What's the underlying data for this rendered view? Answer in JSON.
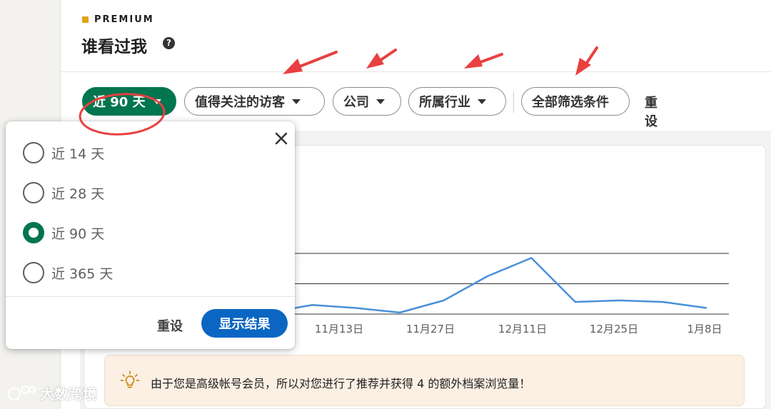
{
  "header": {
    "premium_label": "PREMIUM",
    "title": "谁看过我",
    "help_glyph": "?"
  },
  "filters": {
    "items": [
      {
        "label": "近 90 天",
        "active": true,
        "has_caret": true
      },
      {
        "label": "值得关注的访客",
        "active": false,
        "has_caret": true
      },
      {
        "label": "公司",
        "active": false,
        "has_caret": true
      },
      {
        "label": "所属行业",
        "active": false,
        "has_caret": true
      },
      {
        "label": "全部筛选条件",
        "active": false,
        "has_caret": false
      }
    ],
    "reset_label": "重设"
  },
  "dropdown": {
    "options": [
      {
        "label": "近 14 天",
        "checked": false
      },
      {
        "label": "近 28 天",
        "checked": false
      },
      {
        "label": "近 90 天",
        "checked": true
      },
      {
        "label": "近 365 天",
        "checked": false
      }
    ],
    "reset_label": "重设",
    "show_results_label": "显示结果"
  },
  "chart_data": {
    "type": "line",
    "categories": [
      "11月13日",
      "11月27日",
      "12月11日",
      "12月25日",
      "1月8日"
    ],
    "series": [
      {
        "values": [
          0.05,
          0.3,
          0.2,
          0.05,
          0.45,
          1.25,
          1.85,
          0.4,
          0.45,
          0.4,
          0.2
        ]
      }
    ],
    "ylim": [
      0,
      2
    ],
    "grid": true,
    "colors": {
      "line": "#4a90d9",
      "grid": "#333333"
    }
  },
  "banner": {
    "text": "由于您是高级帐号会员，所以对您进行了推荐并获得 4 的额外档案浏览量！",
    "icon": "lightbulb-icon"
  },
  "watermark": {
    "text": "大数跨境"
  },
  "colors": {
    "accent_green": "#01754f",
    "primary_blue": "#0a66c2",
    "premium_gold": "#e3a01b",
    "annotation_red": "#e94040"
  }
}
